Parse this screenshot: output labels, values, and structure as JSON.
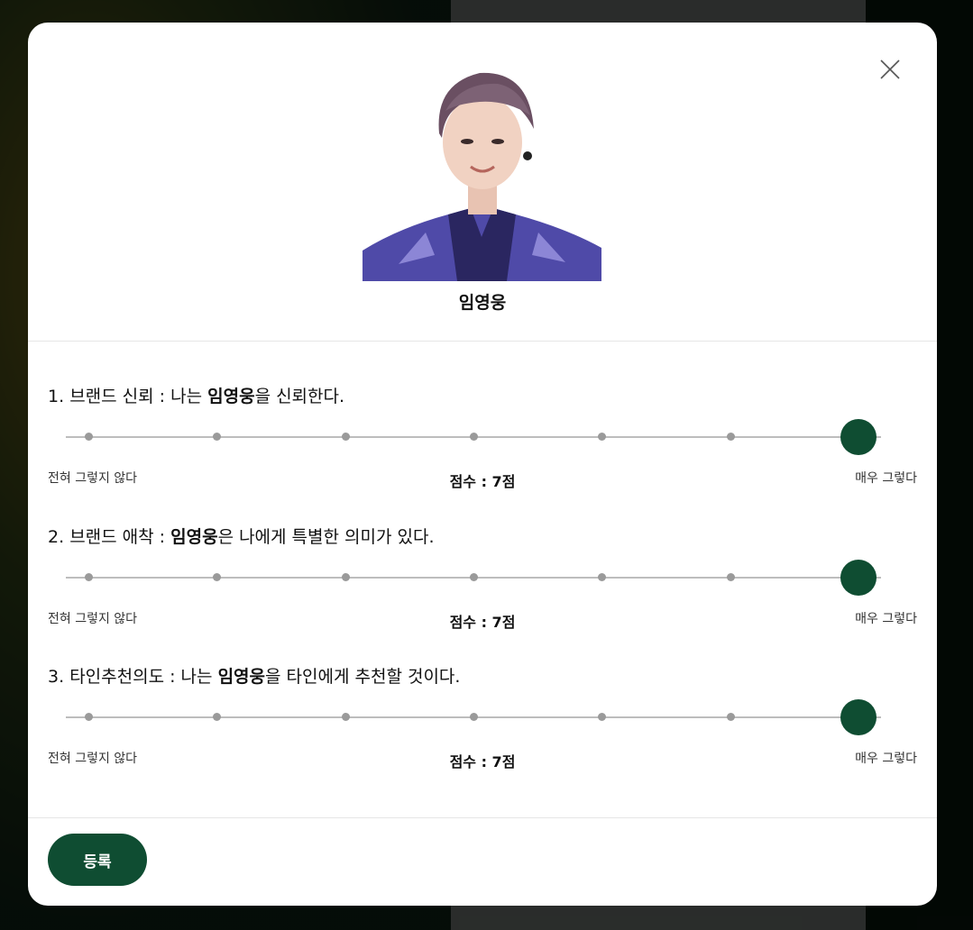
{
  "profile": {
    "name": "임영웅",
    "photo_label": "artist-photo"
  },
  "questions": [
    {
      "number": "1.",
      "prefix": "브랜드 신뢰 : 나는 ",
      "bold": "임영웅",
      "suffix": "을 신뢰한다.",
      "score_label": "점수 : 7점",
      "min_label": "전혀 그렇지 않다",
      "max_label": "매우 그렇다",
      "value": 7,
      "scale_max": 7
    },
    {
      "number": "2.",
      "prefix": "브랜드 애착 : ",
      "bold": "임영웅",
      "suffix": "은 나에게 특별한 의미가 있다.",
      "score_label": "점수 : 7점",
      "min_label": "전혀 그렇지 않다",
      "max_label": "매우 그렇다",
      "value": 7,
      "scale_max": 7
    },
    {
      "number": "3.",
      "prefix": "타인추천의도 : 나는 ",
      "bold": "임영웅",
      "suffix": "을 타인에게 추천할 것이다.",
      "score_label": "점수 : 7점",
      "min_label": "전혀 그렇지 않다",
      "max_label": "매우 그렇다",
      "value": 7,
      "scale_max": 7
    }
  ],
  "footer": {
    "submit_label": "등록"
  },
  "colors": {
    "accent": "#0f4d32",
    "track": "#bdbdbd",
    "tick": "#9a9a9a"
  },
  "icons": {
    "close": "close-icon"
  }
}
